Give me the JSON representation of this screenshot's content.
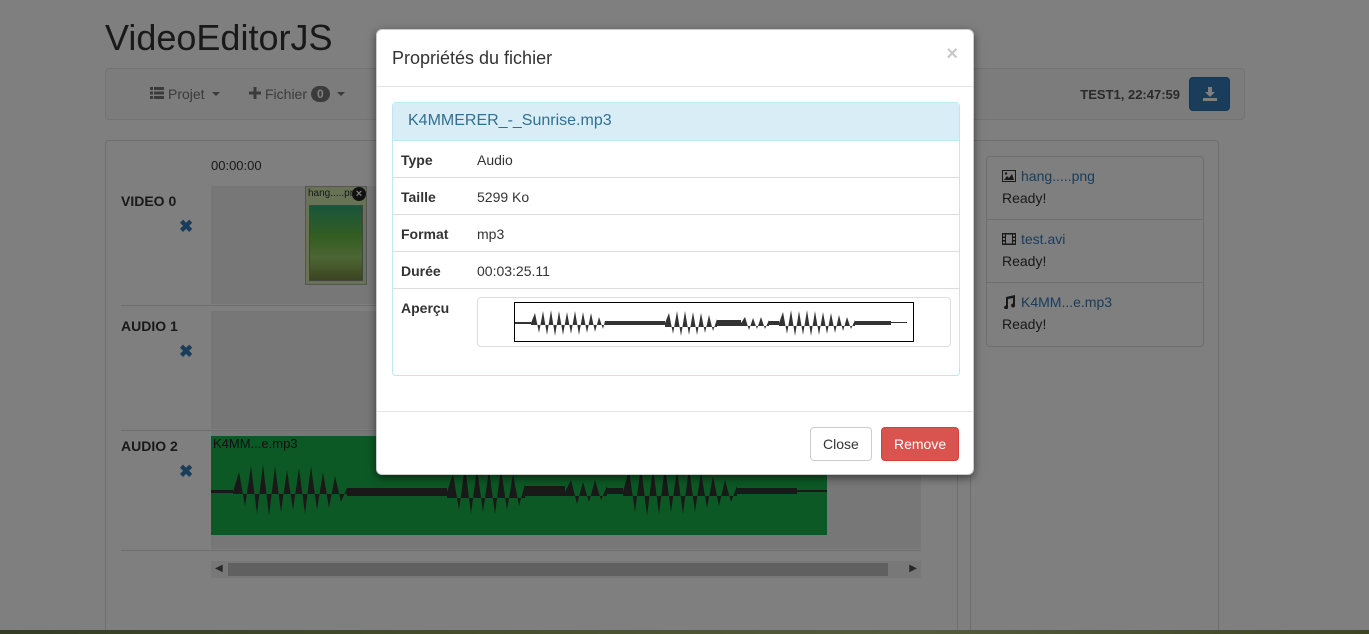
{
  "app": {
    "title": "VideoEditorJS"
  },
  "navbar": {
    "projet_label": "Projet",
    "fichier_label": "Fichier",
    "fichier_count": "0",
    "status": "TEST1, 22:47:59"
  },
  "timeline": {
    "timecode": "00:00:00",
    "tracks": [
      {
        "label": "VIDEO 0"
      },
      {
        "label": "AUDIO 1"
      },
      {
        "label": "AUDIO 2"
      }
    ],
    "image_clip_label": "hang.....png",
    "audio_clip_label": "K4MM...e.mp3"
  },
  "files": [
    {
      "name": "hang.....png",
      "icon": "image-icon",
      "status": "Ready!"
    },
    {
      "name": "test.avi",
      "icon": "film-icon",
      "status": "Ready!"
    },
    {
      "name": "K4MM...e.mp3",
      "icon": "music-icon",
      "status": "Ready!"
    }
  ],
  "modal": {
    "title": "Propriétés du fichier",
    "close_glyph": "×",
    "file_name": "K4MMERER_-_Sunrise.mp3",
    "properties": [
      {
        "key": "Type",
        "value": "Audio"
      },
      {
        "key": "Taille",
        "value": "5299 Ko"
      },
      {
        "key": "Format",
        "value": "mp3"
      },
      {
        "key": "Durée",
        "value": "00:03:25.11"
      }
    ],
    "preview_label": "Aperçu",
    "close_button": "Close",
    "remove_button": "Remove"
  },
  "colors": {
    "primary": "#337ab7",
    "danger": "#d9534f",
    "audio_clip": "#19b24a",
    "panel_heading": "#d9edf7"
  }
}
